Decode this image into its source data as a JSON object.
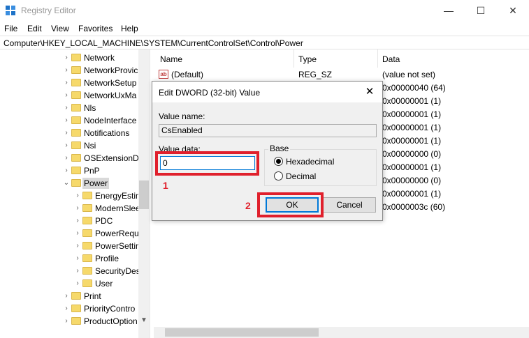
{
  "window": {
    "title": "Registry Editor",
    "controls": {
      "minimize": "—",
      "maximize": "☐",
      "close": "✕"
    }
  },
  "menu": [
    "File",
    "Edit",
    "View",
    "Favorites",
    "Help"
  ],
  "address": "Computer\\HKEY_LOCAL_MACHINE\\SYSTEM\\CurrentControlSet\\Control\\Power",
  "tree": [
    {
      "label": "Network",
      "level": 1
    },
    {
      "label": "NetworkProvic",
      "level": 1
    },
    {
      "label": "NetworkSetup",
      "level": 1
    },
    {
      "label": "NetworkUxMa",
      "level": 1
    },
    {
      "label": "Nls",
      "level": 1
    },
    {
      "label": "NodeInterface",
      "level": 1
    },
    {
      "label": "Notifications",
      "level": 1
    },
    {
      "label": "Nsi",
      "level": 1
    },
    {
      "label": "OSExtensionDa",
      "level": 1
    },
    {
      "label": "PnP",
      "level": 1
    },
    {
      "label": "Power",
      "level": 1,
      "expanded": true,
      "selected": true
    },
    {
      "label": "EnergyEstim",
      "level": 2
    },
    {
      "label": "ModernSlee",
      "level": 2
    },
    {
      "label": "PDC",
      "level": 2
    },
    {
      "label": "PowerRequ",
      "level": 2
    },
    {
      "label": "PowerSettin",
      "level": 2
    },
    {
      "label": "Profile",
      "level": 2
    },
    {
      "label": "SecurityDes",
      "level": 2
    },
    {
      "label": "User",
      "level": 2
    },
    {
      "label": "Print",
      "level": 1
    },
    {
      "label": "PriorityContro",
      "level": 1
    },
    {
      "label": "ProductOption",
      "level": 1
    }
  ],
  "list": {
    "columns": [
      "Name",
      "Type",
      "Data"
    ],
    "rows": [
      {
        "name": "(Default)",
        "icon": "ab",
        "type": "REG_SZ",
        "data": "(value not set)"
      },
      {
        "data": "0x00000040 (64)"
      },
      {
        "data": "0x00000001 (1)"
      },
      {
        "data": "0x00000001 (1)"
      },
      {
        "data": "0x00000001 (1)"
      },
      {
        "data": "0x00000001 (1)"
      },
      {
        "data": "0x00000000 (0)"
      },
      {
        "data": "0x00000001 (1)"
      },
      {
        "data": "0x00000000 (0)"
      },
      {
        "data": "0x00000001 (1)"
      },
      {
        "data": "0x0000003c (60)"
      }
    ]
  },
  "dialog": {
    "title": "Edit DWORD (32-bit) Value",
    "value_name_label": "Value name:",
    "value_name": "CsEnabled",
    "value_data_label": "Value data:",
    "value_data": "0",
    "base_label": "Base",
    "radio_hex": "Hexadecimal",
    "radio_dec": "Decimal",
    "selected_base": "Hexadecimal",
    "ok_label": "OK",
    "cancel_label": "Cancel",
    "close_glyph": "✕"
  },
  "annotations": {
    "step1": "1",
    "step2": "2",
    "highlight_color": "#e0202c"
  }
}
